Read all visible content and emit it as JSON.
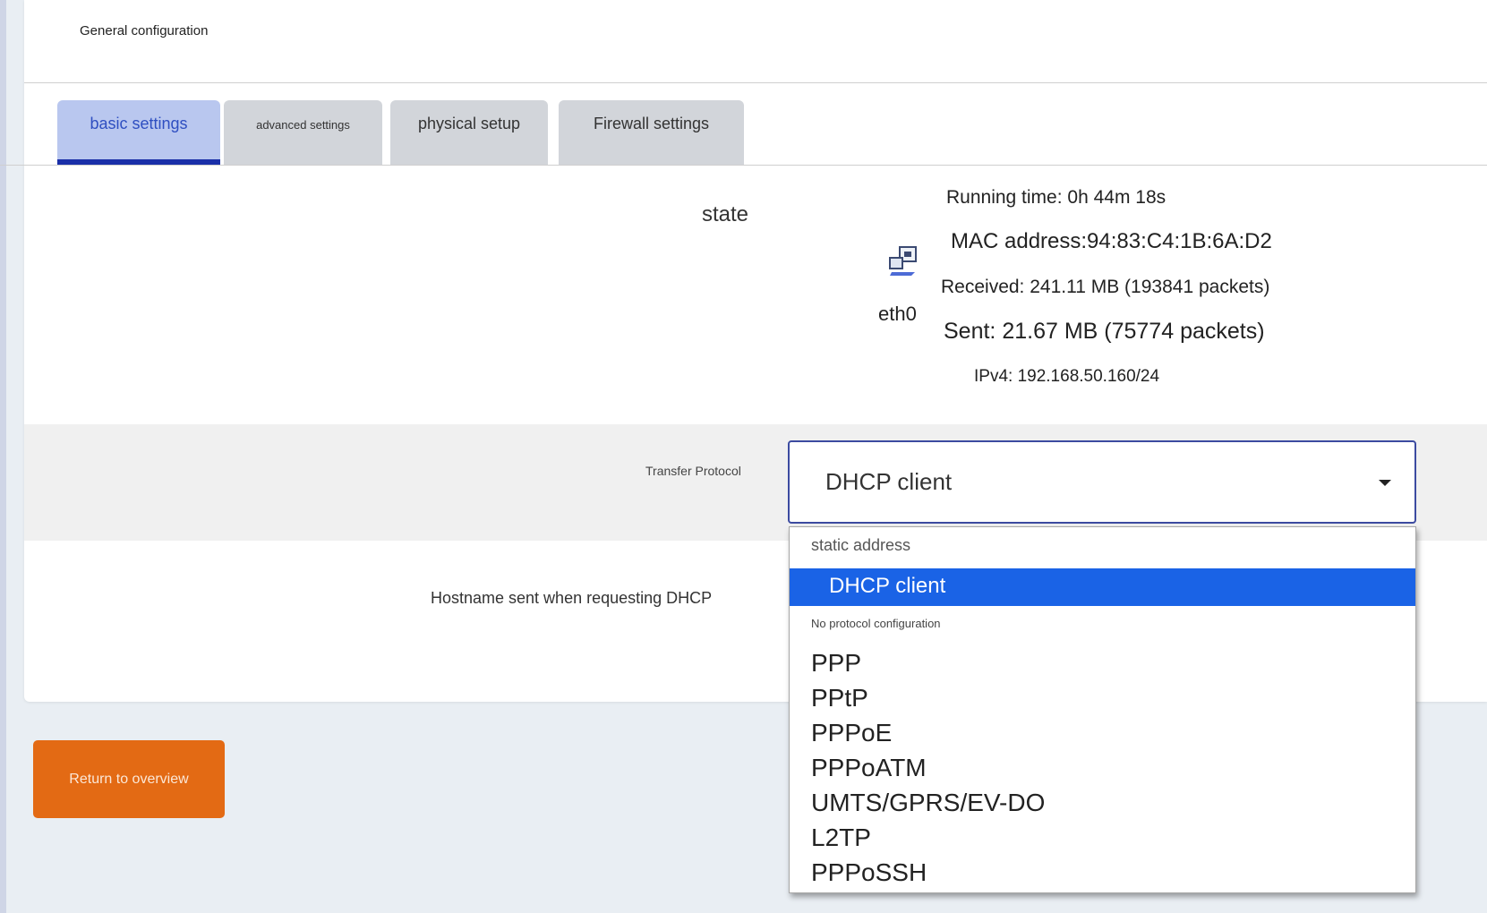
{
  "section": {
    "title": "General configuration"
  },
  "tabs": [
    {
      "label": "basic settings",
      "active": true
    },
    {
      "label": "advanced settings",
      "active": false
    },
    {
      "label": "physical setup",
      "active": false
    },
    {
      "label": "Firewall settings",
      "active": false
    }
  ],
  "status": {
    "label": "state",
    "interface": "eth0",
    "icon": "network-interface-icon",
    "running_time": "Running time: 0h 44m 18s",
    "mac": "MAC address:94:83:C4:1B:6A:D2",
    "received": "Received: 241.11 MB (193841 packets)",
    "sent": "Sent: 21.67 MB (75774 packets)",
    "ipv4": "IPv4: 192.168.50.160/24"
  },
  "protocol": {
    "label": "Transfer Protocol",
    "selected": "DHCP client",
    "options": [
      "static address",
      "DHCP client",
      "No protocol configuration",
      "PPP",
      "PPtP",
      "PPPoE",
      "PPPoATM",
      "UMTS/GPRS/EV-DO",
      "L2TP",
      "PPPoSSH"
    ]
  },
  "hostname": {
    "label": "Hostname sent when requesting DHCP"
  },
  "footer": {
    "return_label": "Return to overview"
  },
  "colors": {
    "tab_active_bg": "#b9c7ef",
    "tab_active_text": "#2f4fc1",
    "selected_option_bg": "#1a63e6",
    "return_button_bg": "#e36a14"
  }
}
